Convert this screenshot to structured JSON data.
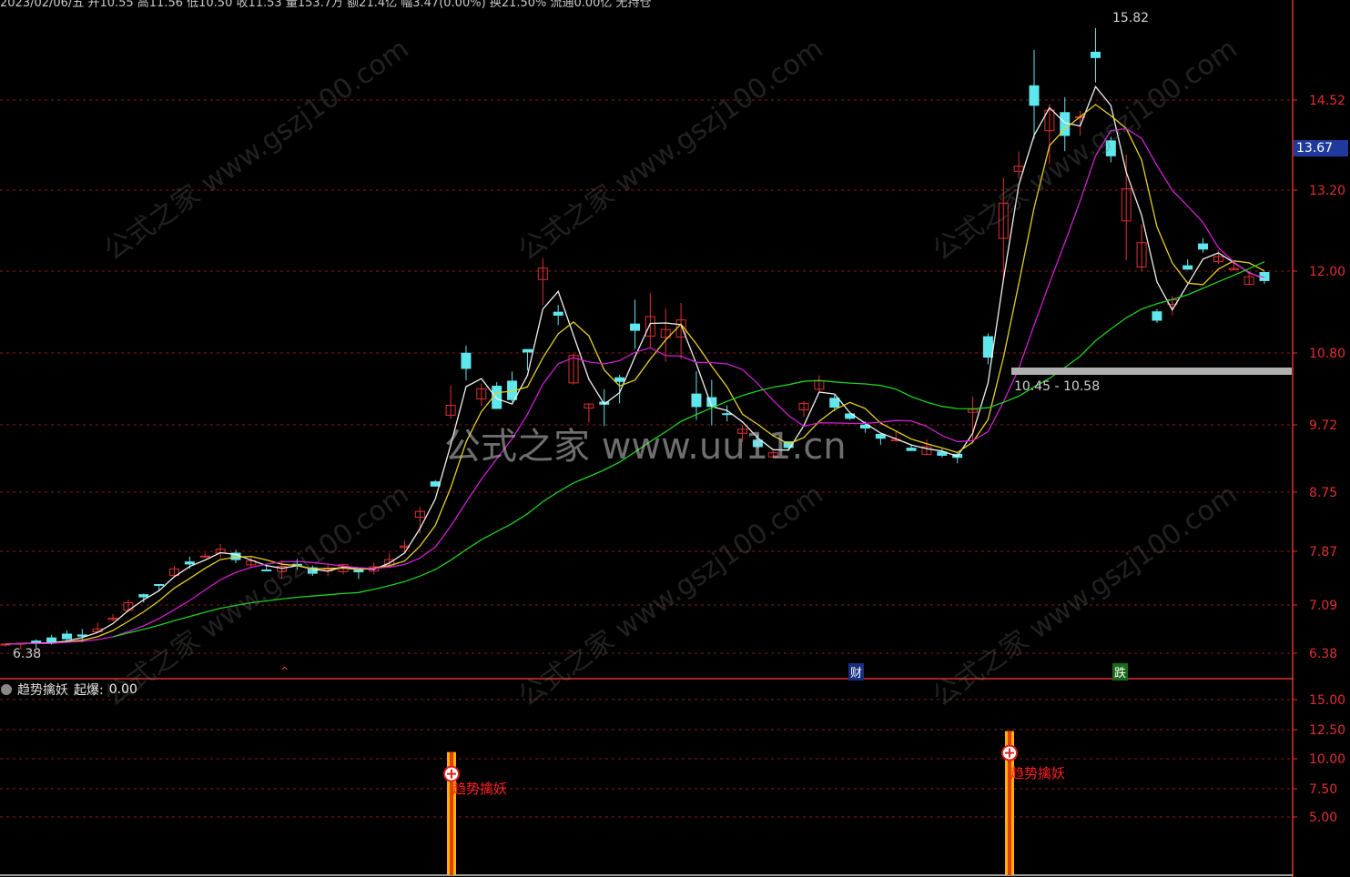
{
  "colors": {
    "background": "#000000",
    "grid": "#8a1a1a",
    "up_candle": "#e03030",
    "down_candle": "#5ee8ee",
    "ma5": "#f0f0f0",
    "ma10": "#e8d020",
    "ma20": "#d020d0",
    "ma60": "#20d020",
    "axis_text": "#e03030",
    "signal_bar": "#ffb000"
  },
  "header": {
    "info_strip": "2023/02/06/五 开10.55 高11.56 低10.50 收11.53 量153.7万 额21.4亿 幅3.47(0.00%) 换21.50% 流通0.00亿 无持仓"
  },
  "main_chart": {
    "y_ticks": [
      "14.52",
      "13.20",
      "12.00",
      "10.80",
      "9.72",
      "8.75",
      "7.87",
      "7.09",
      "6.38"
    ],
    "current_price_tag": "13.67",
    "high_label": "15.82",
    "low_label": "6.38",
    "range_label": "10.45 - 10.58",
    "markers": {
      "cai": "财",
      "die": "跌",
      "up": "^"
    }
  },
  "watermarks": {
    "main": "公式之家 www.uu11.cn",
    "diagonal": "公式之家 www.gszj100.com"
  },
  "indicator": {
    "icon": "indicator-toggle-icon",
    "name": "趋势擒妖",
    "param_label": "起爆:",
    "param_value": "0.00",
    "y_ticks": [
      "15.00",
      "12.50",
      "10.00",
      "7.50",
      "5.00"
    ],
    "signals": [
      {
        "label": "趋势擒妖",
        "value": 8.7
      },
      {
        "label": "趋势擒妖",
        "value": 10.5
      }
    ]
  }
}
